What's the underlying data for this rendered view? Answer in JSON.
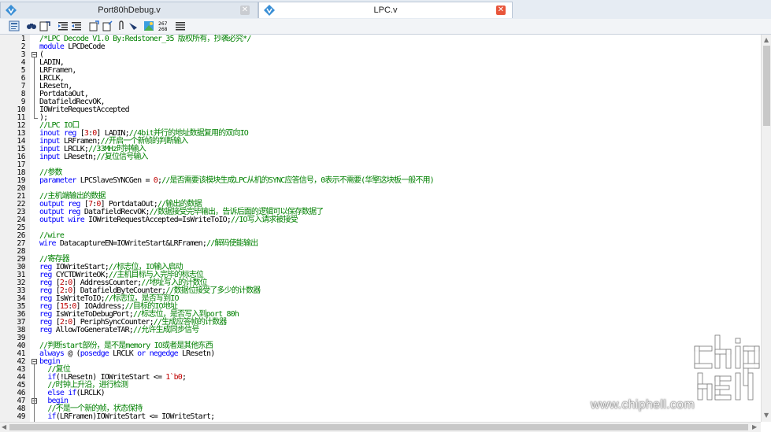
{
  "tabs": [
    {
      "title": "Port80hDebug.v",
      "active": false
    },
    {
      "title": "LPC.v",
      "active": true
    }
  ],
  "toolbar": {
    "icons": [
      "bookmark-icon",
      "find-icon",
      "find-next-icon",
      "indent-icon",
      "outdent-icon",
      "open-file-icon",
      "save-file-icon",
      "attach-icon",
      "marker-icon",
      "browser-icon",
      "line-number-icon",
      "list-icon"
    ],
    "line_number_label_top": "267",
    "line_number_label_bottom": "268"
  },
  "editor": {
    "lines": [
      {
        "n": "1",
        "fold": "",
        "segs": [
          [
            "com",
            "/*LPC Decode V1.0 By:Redstoner_35 版权所有，抄袭必究*/"
          ]
        ]
      },
      {
        "n": "2",
        "fold": "",
        "segs": [
          [
            "kw",
            "module "
          ],
          [
            "txt",
            "LPCDeCode"
          ]
        ]
      },
      {
        "n": "3",
        "fold": "minus",
        "segs": [
          [
            "txt",
            "("
          ]
        ]
      },
      {
        "n": "4",
        "fold": "",
        "segs": [
          [
            "txt",
            "LADIN,"
          ]
        ]
      },
      {
        "n": "5",
        "fold": "",
        "segs": [
          [
            "txt",
            "LRFramen,"
          ]
        ]
      },
      {
        "n": "6",
        "fold": "",
        "segs": [
          [
            "txt",
            "LRCLK,"
          ]
        ]
      },
      {
        "n": "7",
        "fold": "",
        "segs": [
          [
            "txt",
            "LResetn,"
          ]
        ]
      },
      {
        "n": "8",
        "fold": "",
        "segs": [
          [
            "txt",
            "PortdataOut,"
          ]
        ]
      },
      {
        "n": "9",
        "fold": "",
        "segs": [
          [
            "txt",
            "DatafieldRecvOK,"
          ]
        ]
      },
      {
        "n": "10",
        "fold": "",
        "segs": [
          [
            "txt",
            "IOWriteRequestAccepted"
          ]
        ]
      },
      {
        "n": "11",
        "fold": "end",
        "segs": [
          [
            "txt",
            ");"
          ]
        ]
      },
      {
        "n": "12",
        "fold": "",
        "segs": [
          [
            "com",
            "//LPC IO口"
          ]
        ]
      },
      {
        "n": "13",
        "fold": "",
        "segs": [
          [
            "kw",
            "inout reg "
          ],
          [
            "txt",
            "["
          ],
          [
            "num",
            "3"
          ],
          [
            "txt",
            ":"
          ],
          [
            "num",
            "0"
          ],
          [
            "txt",
            "] LADIN;"
          ],
          [
            "com",
            "//4bit并行的地址数据复用的双向IO"
          ]
        ]
      },
      {
        "n": "14",
        "fold": "",
        "segs": [
          [
            "kw",
            "input "
          ],
          [
            "txt",
            "LRFramen;"
          ],
          [
            "com",
            "//开启一个新帧的判断输入"
          ]
        ]
      },
      {
        "n": "15",
        "fold": "",
        "segs": [
          [
            "kw",
            "input "
          ],
          [
            "txt",
            "LRCLK;"
          ],
          [
            "com",
            "//33MHz时钟输入"
          ]
        ]
      },
      {
        "n": "16",
        "fold": "",
        "segs": [
          [
            "kw",
            "input "
          ],
          [
            "txt",
            "LResetn;"
          ],
          [
            "com",
            "//复位信号输入"
          ]
        ]
      },
      {
        "n": "17",
        "fold": "",
        "segs": []
      },
      {
        "n": "18",
        "fold": "",
        "segs": [
          [
            "com",
            "//参数"
          ]
        ]
      },
      {
        "n": "19",
        "fold": "",
        "segs": [
          [
            "kw",
            "parameter "
          ],
          [
            "txt",
            "LPCSlaveSYNCGen = "
          ],
          [
            "num",
            "0"
          ],
          [
            "txt",
            ";"
          ],
          [
            "com",
            "//是否需要该模块生成LPC从机的SYNC应答信号，0表示不需要(华擎这块板一般不用)"
          ]
        ]
      },
      {
        "n": "20",
        "fold": "",
        "segs": []
      },
      {
        "n": "21",
        "fold": "",
        "segs": [
          [
            "com",
            "//主机端输出的数据"
          ]
        ]
      },
      {
        "n": "22",
        "fold": "",
        "segs": [
          [
            "kw",
            "output reg "
          ],
          [
            "txt",
            "["
          ],
          [
            "num",
            "7"
          ],
          [
            "txt",
            ":"
          ],
          [
            "num",
            "0"
          ],
          [
            "txt",
            "] PortdataOut;"
          ],
          [
            "com",
            "//输出的数据"
          ]
        ]
      },
      {
        "n": "23",
        "fold": "",
        "segs": [
          [
            "kw",
            "output reg "
          ],
          [
            "txt",
            "DatafieldRecvOK;"
          ],
          [
            "com",
            "//数据接受完毕输出，告诉后面的逻辑可以保存数据了"
          ]
        ]
      },
      {
        "n": "24",
        "fold": "",
        "segs": [
          [
            "kw",
            "output wire "
          ],
          [
            "txt",
            "IOWriteRequestAccepted=IsWriteToIO;"
          ],
          [
            "com",
            "//IO写入请求被接受"
          ]
        ]
      },
      {
        "n": "25",
        "fold": "",
        "segs": []
      },
      {
        "n": "26",
        "fold": "",
        "segs": [
          [
            "com",
            "//wire"
          ]
        ]
      },
      {
        "n": "27",
        "fold": "",
        "segs": [
          [
            "kw",
            "wire "
          ],
          [
            "txt",
            "DatacaptureEN=IOWriteStart&LRFramen;"
          ],
          [
            "com",
            "//解码使能输出"
          ]
        ]
      },
      {
        "n": "28",
        "fold": "",
        "segs": []
      },
      {
        "n": "29",
        "fold": "",
        "segs": [
          [
            "com",
            "//寄存器"
          ]
        ]
      },
      {
        "n": "30",
        "fold": "",
        "segs": [
          [
            "kw",
            "reg "
          ],
          [
            "txt",
            "IOWriteStart;"
          ],
          [
            "com",
            "//标志位，IO输入启动"
          ]
        ]
      },
      {
        "n": "31",
        "fold": "",
        "segs": [
          [
            "kw",
            "reg "
          ],
          [
            "txt",
            "CYCTDWriteOK;"
          ],
          [
            "com",
            "//主机目标与入完毕的标志位"
          ]
        ]
      },
      {
        "n": "32",
        "fold": "",
        "segs": [
          [
            "kw",
            "reg "
          ],
          [
            "txt",
            "["
          ],
          [
            "num",
            "2"
          ],
          [
            "txt",
            ":"
          ],
          [
            "num",
            "0"
          ],
          [
            "txt",
            "] AddressCounter;"
          ],
          [
            "com",
            "//地址写入的计数位"
          ]
        ]
      },
      {
        "n": "33",
        "fold": "",
        "segs": [
          [
            "kw",
            "reg "
          ],
          [
            "txt",
            "["
          ],
          [
            "num",
            "2"
          ],
          [
            "txt",
            ":"
          ],
          [
            "num",
            "0"
          ],
          [
            "txt",
            "] DatafieldByteCounter;"
          ],
          [
            "com",
            "//数据位接受了多少的计数器"
          ]
        ]
      },
      {
        "n": "34",
        "fold": "",
        "segs": [
          [
            "kw",
            "reg "
          ],
          [
            "txt",
            "IsWriteToIO;"
          ],
          [
            "com",
            "//标志位，是否写到IO"
          ]
        ]
      },
      {
        "n": "35",
        "fold": "",
        "segs": [
          [
            "kw",
            "reg "
          ],
          [
            "txt",
            "["
          ],
          [
            "num",
            "15"
          ],
          [
            "txt",
            ":"
          ],
          [
            "num",
            "0"
          ],
          [
            "txt",
            "] IOAddress;"
          ],
          [
            "com",
            "//目标的IO地址"
          ]
        ]
      },
      {
        "n": "36",
        "fold": "",
        "segs": [
          [
            "kw",
            "reg "
          ],
          [
            "txt",
            "IsWriteToDebugPort;"
          ],
          [
            "com",
            "//标志位，是否写入到port 80h"
          ]
        ]
      },
      {
        "n": "37",
        "fold": "",
        "segs": [
          [
            "kw",
            "reg "
          ],
          [
            "txt",
            "["
          ],
          [
            "num",
            "2"
          ],
          [
            "txt",
            ":"
          ],
          [
            "num",
            "0"
          ],
          [
            "txt",
            "] PeriphSyncCounter;"
          ],
          [
            "com",
            "//生成应答帧的计数器"
          ]
        ]
      },
      {
        "n": "38",
        "fold": "",
        "segs": [
          [
            "kw",
            "reg "
          ],
          [
            "txt",
            "AllowToGenerateTAR;"
          ],
          [
            "com",
            "//允许生成同步信号"
          ]
        ]
      },
      {
        "n": "39",
        "fold": "",
        "segs": []
      },
      {
        "n": "40",
        "fold": "",
        "segs": [
          [
            "com",
            "//判断start部份，是不是memory IO或者是其他东西"
          ]
        ]
      },
      {
        "n": "41",
        "fold": "",
        "segs": [
          [
            "kw",
            "always "
          ],
          [
            "txt",
            "@ ("
          ],
          [
            "kw",
            "posedge "
          ],
          [
            "txt",
            "LRCLK "
          ],
          [
            "kw",
            "or negedge "
          ],
          [
            "txt",
            "LResetn)"
          ]
        ]
      },
      {
        "n": "42",
        "fold": "minus",
        "segs": [
          [
            "kw",
            "begin"
          ]
        ]
      },
      {
        "n": "43",
        "fold": "",
        "segs": [
          [
            "com",
            "  //复位"
          ]
        ]
      },
      {
        "n": "44",
        "fold": "",
        "segs": [
          [
            "kw",
            "  if"
          ],
          [
            "txt",
            "(!LResetn) IOWriteStart <= "
          ],
          [
            "num",
            "1`b0"
          ],
          [
            "txt",
            ";"
          ]
        ]
      },
      {
        "n": "45",
        "fold": "",
        "segs": [
          [
            "com",
            "  //时钟上升沿，进行检测"
          ]
        ]
      },
      {
        "n": "46",
        "fold": "",
        "segs": [
          [
            "kw",
            "  else if"
          ],
          [
            "txt",
            "(LRCLK)"
          ]
        ]
      },
      {
        "n": "47",
        "fold": "minus",
        "segs": [
          [
            "kw",
            "  begin"
          ]
        ]
      },
      {
        "n": "48",
        "fold": "",
        "segs": [
          [
            "com",
            "  //不是一个新的帧，状态保持"
          ]
        ]
      },
      {
        "n": "49",
        "fold": "",
        "segs": [
          [
            "kw",
            "  if"
          ],
          [
            "txt",
            "(LRFramen)IOWriteStart <= IOWriteStart;"
          ]
        ]
      }
    ]
  },
  "watermark": {
    "text": "www.chiphell.com",
    "logo": "chiphell-logo"
  }
}
